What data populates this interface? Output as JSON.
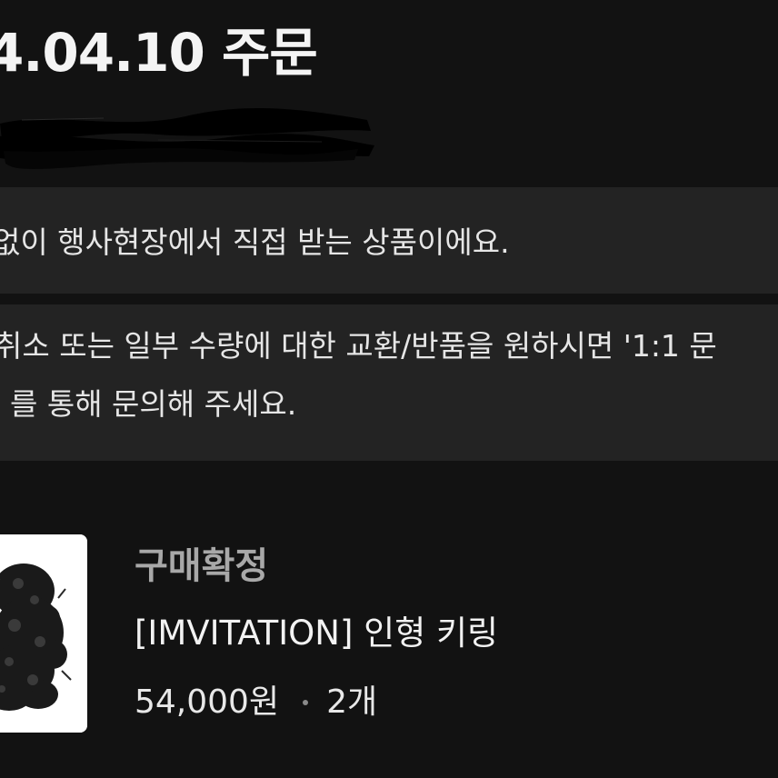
{
  "order": {
    "title": "4.04.10 주문"
  },
  "notices": {
    "event_pickup": "없이 행사현장에서 직접 받는 상품이에요.",
    "cancel_line1": "취소 또는 일부 수량에 대한 교환/반품을 원하시면 '1:1 문",
    "cancel_line2": "를 통해 문의해 주세요."
  },
  "item": {
    "status": "구매확정",
    "name": "[IMVITATION] 인형 키링",
    "price": "54,000원",
    "quantity": "2개"
  },
  "colors": {
    "background": "#121212",
    "notice_bg": "#232323",
    "status_text": "#a8a8a8"
  }
}
